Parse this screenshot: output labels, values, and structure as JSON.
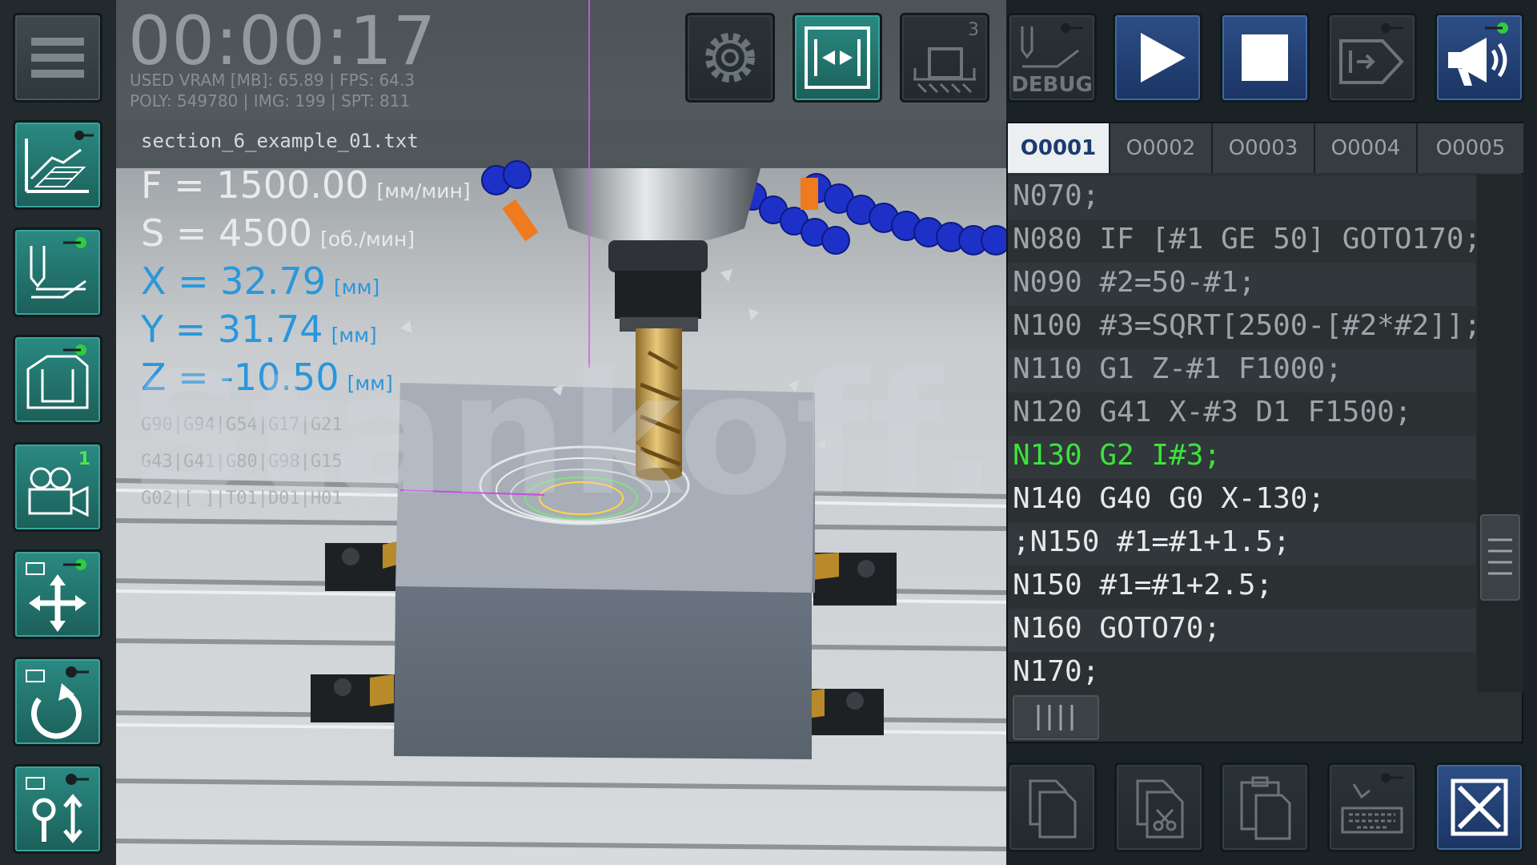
{
  "hud": {
    "timer": "00:00:17",
    "stats_line1": "USED VRAM [MB]: 65.89 | FPS: 64.3",
    "stats_line2": "POLY: 549780 | IMG: 199 | SPT: 811",
    "filename": "section_6_example_01.txt",
    "feed": {
      "label": "F = 1500.00",
      "unit": "[мм/мин]"
    },
    "spindle": {
      "label": "S = 4500",
      "unit": "[об./мин]"
    },
    "x": {
      "label": "X = 32.79",
      "unit": "[мм]"
    },
    "y": {
      "label": "Y = 31.74",
      "unit": "[мм]"
    },
    "z": {
      "label": "Z = -10.50",
      "unit": "[мм]"
    },
    "modal_1": "G90|G94|G54|G17|G21",
    "modal_2": "G43|G41|G80|G98|G15",
    "modal_3": "G02|[ ]|T01|D01|H01",
    "watermark": "Stankoff.RU"
  },
  "left_toolbar": {
    "camera_badge": "1"
  },
  "top_toolbar": {
    "tool_count": "3",
    "debug_label": "DEBUG"
  },
  "editor": {
    "tabs": [
      "O0001",
      "O0002",
      "O0003",
      "O0004",
      "O0005"
    ],
    "active_tab": "O0001",
    "lines": [
      "N070;",
      "N080 IF [#1 GE 50] GOTO170;",
      "N090 #2=50-#1;",
      "N100 #3=SQRT[2500-[#2*#2]];",
      "N110 G1 Z-#1 F1000;",
      "N120 G41 X-#3 D1 F1500;",
      "N130 G2 I#3;",
      "N140 G40 G0 X-130;",
      ";N150 #1=#1+1.5;",
      "N150 #1=#1+2.5;",
      "N160 GOTO70;",
      "N170;"
    ],
    "current_line_index": 6
  },
  "colors": {
    "teal_button": "#2a8a82",
    "blue_button": "#2d4e86",
    "axis_blue": "#2a97db",
    "current_line_green": "#3de23d",
    "indicator_green": "#2ecc40"
  }
}
